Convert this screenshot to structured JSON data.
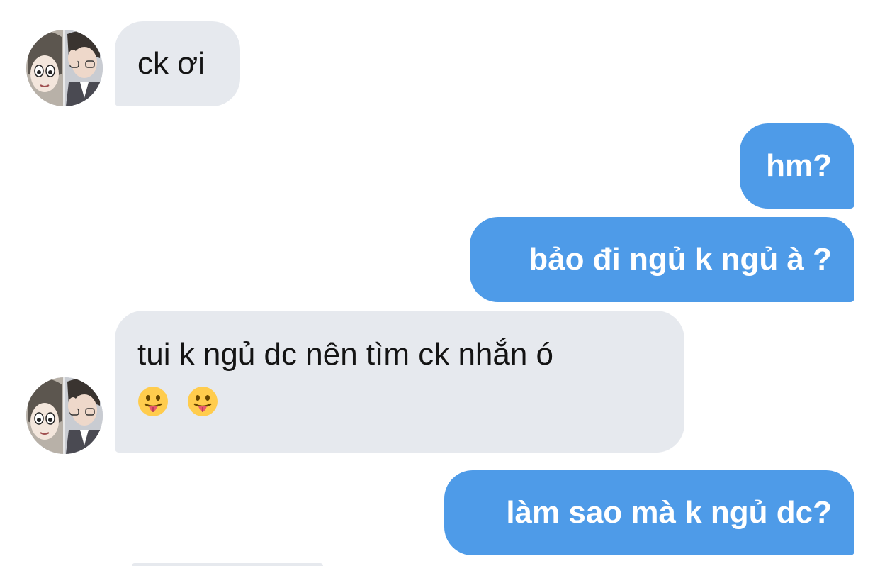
{
  "messages": [
    {
      "direction": "incoming",
      "text": "ck ơi"
    },
    {
      "direction": "outgoing",
      "text": "hm?"
    },
    {
      "direction": "outgoing",
      "text": "bảo đi ngủ k ngủ à ?"
    },
    {
      "direction": "incoming",
      "text": "tui k ngủ dc nên tìm ck nhắn ó",
      "emoji": [
        "😛",
        "😛"
      ]
    },
    {
      "direction": "outgoing",
      "text": "làm sao mà k ngủ dc?"
    }
  ],
  "colors": {
    "incoming_bubble": "#e6e9ee",
    "outgoing_bubble": "#4e9be8",
    "background": "#ffffff"
  },
  "icons": {
    "avatar": "contact-avatar-photo",
    "emoji": "face-with-tongue"
  }
}
